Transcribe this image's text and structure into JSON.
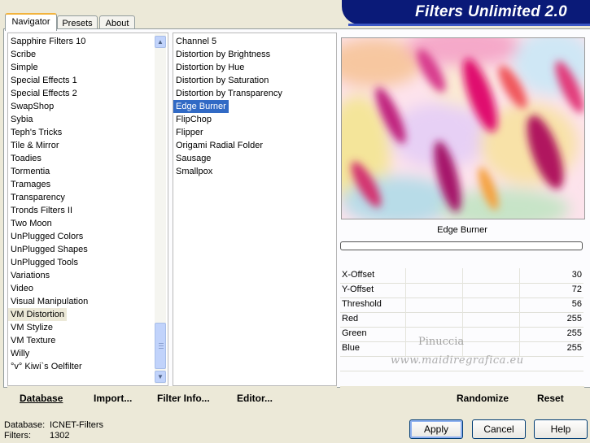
{
  "app": {
    "title": "Filters Unlimited 2.0"
  },
  "tabs": [
    {
      "label": "Navigator",
      "active": true
    },
    {
      "label": "Presets",
      "active": false
    },
    {
      "label": "About",
      "active": false
    }
  ],
  "categories": [
    "Sapphire Filters 10",
    "Scribe",
    "Simple",
    "Special Effects 1",
    "Special Effects 2",
    "SwapShop",
    "Sybia",
    "Teph's Tricks",
    "Tile & Mirror",
    "Toadies",
    "Tormentia",
    "Tramages",
    "Transparency",
    "Tronds Filters II",
    "Two Moon",
    "UnPlugged Colors",
    "UnPlugged Shapes",
    "UnPlugged Tools",
    "Variations",
    "Video",
    "Visual Manipulation",
    "VM Distortion",
    "VM Stylize",
    "VM Texture",
    "Willy",
    "°v° Kiwi`s Oelfilter"
  ],
  "selected_category": "VM Distortion",
  "filters": [
    "Channel 5",
    "Distortion by Brightness",
    "Distortion by Hue",
    "Distortion by Saturation",
    "Distortion by Transparency",
    "Edge Burner",
    "FlipChop",
    "Flipper",
    "Origami Radial Folder",
    "Sausage",
    "Smallpox"
  ],
  "selected_filter": "Edge Burner",
  "preview": {
    "filter_name": "Edge Burner",
    "progress": 0
  },
  "parameters": [
    {
      "name": "X-Offset",
      "value": "30"
    },
    {
      "name": "Y-Offset",
      "value": "72"
    },
    {
      "name": "Threshold",
      "value": "56"
    },
    {
      "name": "Red",
      "value": "255"
    },
    {
      "name": "Green",
      "value": "255"
    },
    {
      "name": "Blue",
      "value": "255"
    }
  ],
  "watermark": {
    "line1": "Pinuccia",
    "line2": "www.maidiregrafica.eu"
  },
  "toolbar": {
    "database": "Database",
    "import": "Import...",
    "filter_info": "Filter Info...",
    "editor": "Editor...",
    "randomize": "Randomize",
    "reset": "Reset"
  },
  "status": {
    "database_label": "Database:",
    "database_value": "ICNET-Filters",
    "filters_label": "Filters:",
    "filters_value": "1302"
  },
  "buttons": {
    "apply": "Apply",
    "cancel": "Cancel",
    "help": "Help"
  },
  "colors": {
    "banner": "#0a1a78",
    "selection": "#316ac5",
    "tab_accent": "#f2b33d"
  }
}
